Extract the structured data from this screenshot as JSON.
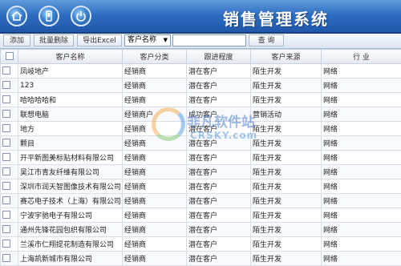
{
  "header": {
    "title": "销售管理系统",
    "icons": [
      "home-icon",
      "phone-icon",
      "power-icon"
    ],
    "bg_color": "#2d6cc0"
  },
  "toolbar": {
    "add_label": "添加",
    "batch_delete_label": "批量删除",
    "export_label": "导出Excel",
    "search_field_selected": "客户名称",
    "search_input_value": "",
    "query_label": "查 询"
  },
  "table": {
    "columns": [
      "客户名称",
      "客户分类",
      "跟进程度",
      "客户来源",
      "行 业"
    ],
    "rows": [
      [
        "凤岐地产",
        "经销商",
        "潜在客户",
        "陌生开发",
        "网络"
      ],
      [
        "123",
        "经销商",
        "潜在客户",
        "陌生开发",
        "网络"
      ],
      [
        "哈哈哈哈和",
        "经销商",
        "潜在客户",
        "陌生开发",
        "网络"
      ],
      [
        "联想电脑",
        "经销商户",
        "成功客户",
        "营销活动",
        "网络"
      ],
      [
        "地方",
        "经销商",
        "潜在客户",
        "陌生开发",
        "网络"
      ],
      [
        "颗目",
        "经销商",
        "潜在客户",
        "陌生开发",
        "网络"
      ],
      [
        "开平新图美标贴材料有限公司",
        "经销商",
        "潜在客户",
        "陌生开发",
        "网络"
      ],
      [
        "吴江市青友纤维有限公司",
        "经销商",
        "潜在客户",
        "陌生开发",
        "网络"
      ],
      [
        "深圳市润天智图像技术有限公司",
        "经销商",
        "潜在客户",
        "陌生开发",
        "网络"
      ],
      [
        "赛芯电子技术（上海）有限公司",
        "经销商",
        "潜在客户",
        "陌生开发",
        "网络"
      ],
      [
        "宁波宇驰电子有限公司",
        "经销商",
        "潜在客户",
        "陌生开发",
        "网络"
      ],
      [
        "通州先锋花园包织有限公司",
        "经销商",
        "潜在客户",
        "陌生开发",
        "网络"
      ],
      [
        "兰溪市仁翔提花制造有限公司",
        "经销商",
        "潜在客户",
        "陌生开发",
        "网络"
      ],
      [
        "上海凯新城市有限公司",
        "经销商",
        "潜在客户",
        "陌生开发",
        "网络"
      ]
    ]
  },
  "watermark": {
    "text": "非凡软件站",
    "sub": "CRSKY.com"
  }
}
